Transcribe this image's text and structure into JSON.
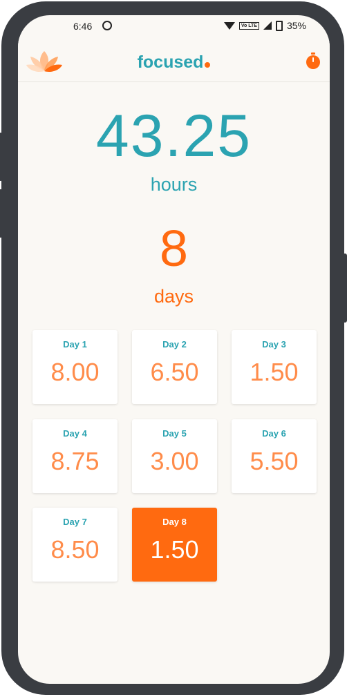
{
  "status_bar": {
    "time": "6:46",
    "lte": "Vo LTE",
    "battery": "35%"
  },
  "app_bar": {
    "title": "focused",
    "logo_icon": "lotus-icon",
    "timer_icon": "stopwatch-icon"
  },
  "stats": {
    "hours_value": "43.25",
    "hours_label": "hours",
    "days_value": "8",
    "days_label": "days"
  },
  "days": [
    {
      "label": "Day 1",
      "value": "8.00"
    },
    {
      "label": "Day 2",
      "value": "6.50"
    },
    {
      "label": "Day 3",
      "value": "1.50"
    },
    {
      "label": "Day 4",
      "value": "8.75"
    },
    {
      "label": "Day 5",
      "value": "3.00"
    },
    {
      "label": "Day 6",
      "value": "5.50"
    },
    {
      "label": "Day 7",
      "value": "8.50"
    },
    {
      "label": "Day 8",
      "value": "1.50",
      "active": true
    }
  ],
  "colors": {
    "teal": "#2ba3b1",
    "orange": "#ff6a10",
    "background": "#faf8f4"
  }
}
